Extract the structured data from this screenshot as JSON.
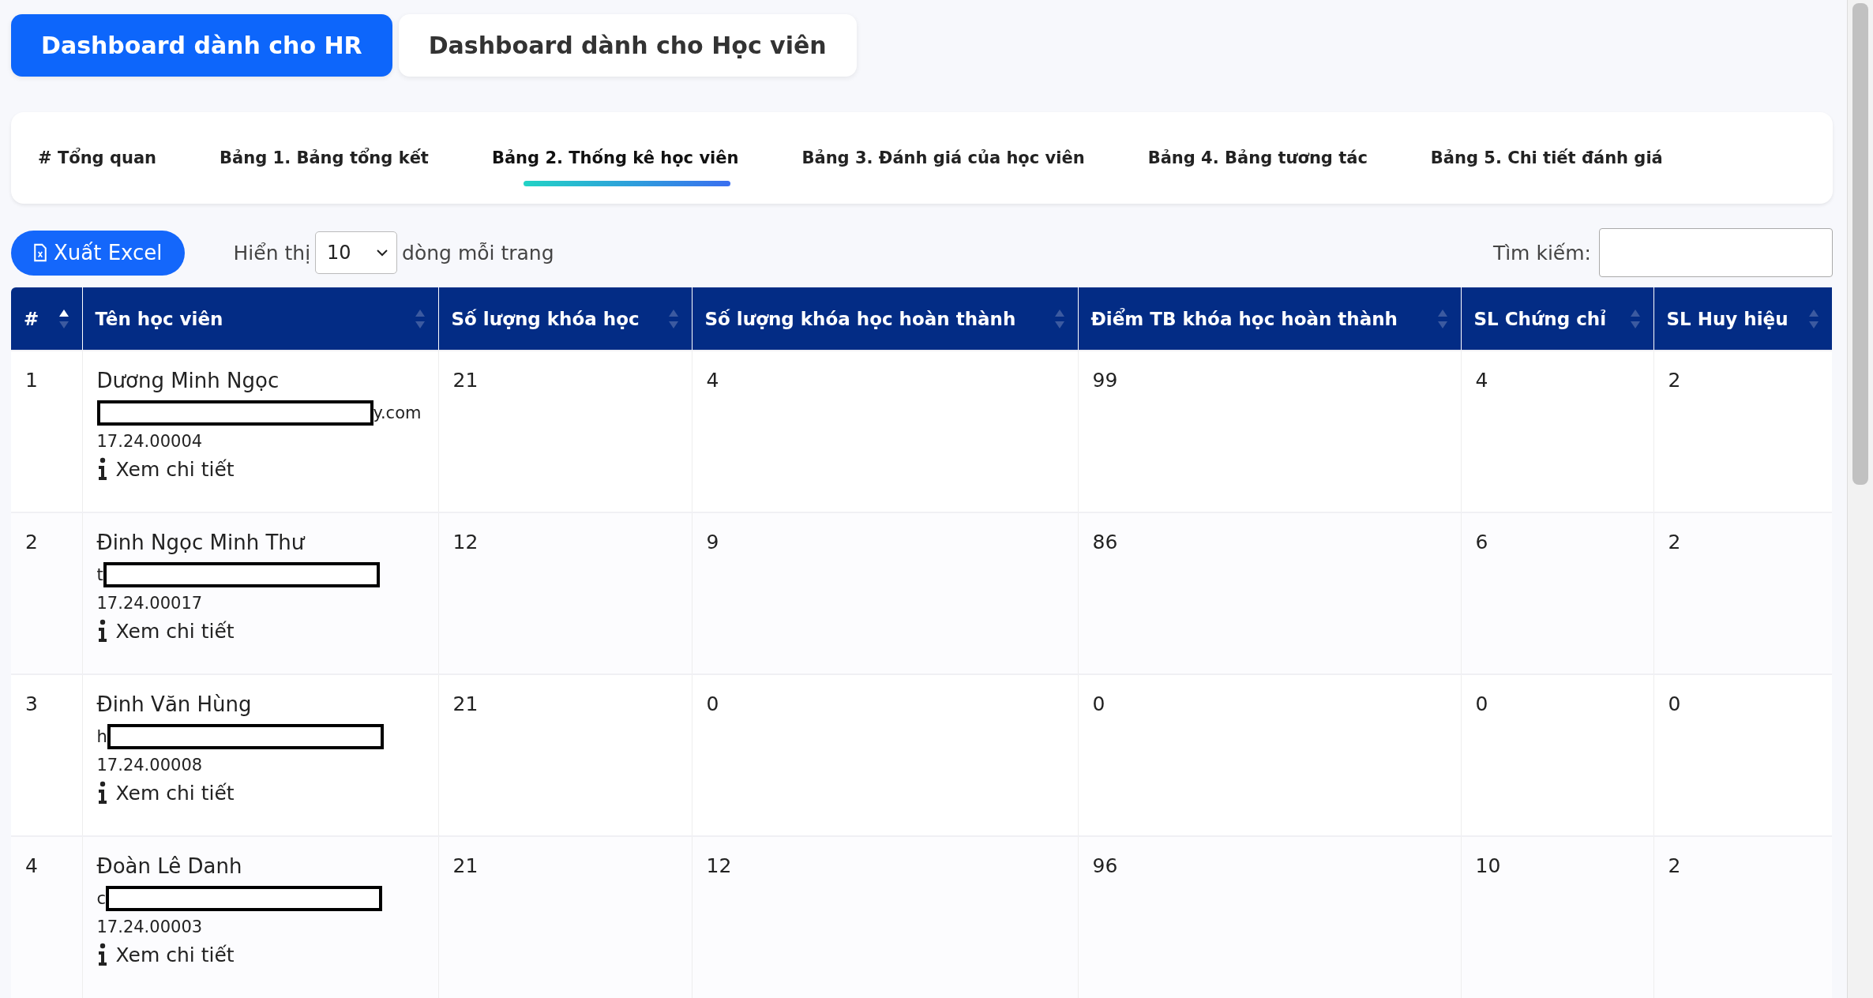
{
  "dashboard_tabs": [
    {
      "label": "Dashboard dành cho HR",
      "selected": true
    },
    {
      "label": "Dashboard dành cho Học viên",
      "selected": false
    }
  ],
  "sub_tabs": [
    {
      "label": "# Tổng quan",
      "selected": false
    },
    {
      "label": "Bảng 1. Bảng tổng kết",
      "selected": false
    },
    {
      "label": "Bảng 2. Thống kê học viên",
      "selected": true
    },
    {
      "label": "Bảng 3. Đánh giá của học viên",
      "selected": false
    },
    {
      "label": "Bảng 4. Bảng tương tác",
      "selected": false
    },
    {
      "label": "Bảng 5. Chi tiết đánh giá",
      "selected": false
    }
  ],
  "toolbar": {
    "export_button": "Xuất Excel",
    "show_label": "Hiển thị",
    "page_size": "10",
    "page_size_suffix": "dòng mỗi trang",
    "search_label": "Tìm kiếm:"
  },
  "table": {
    "columns": [
      {
        "label": "#",
        "sorted_ascending": true
      },
      {
        "label": "Tên học viên",
        "sorted_ascending": false
      },
      {
        "label": "Số lượng khóa học",
        "sorted_ascending": false
      },
      {
        "label": "Số lượng khóa học hoàn thành",
        "sorted_ascending": false
      },
      {
        "label": "Điểm TB khóa học hoàn thành",
        "sorted_ascending": false
      },
      {
        "label": "SL Chứng chỉ",
        "sorted_ascending": false
      },
      {
        "label": "SL Huy hiệu",
        "sorted_ascending": false
      }
    ],
    "rows": [
      {
        "index": "1",
        "name": "Dương Minh Ngọc",
        "email_visible": "y.com",
        "redaction_before": true,
        "code": "17.24.00004",
        "details_link": "Xem chi tiết",
        "courses": "21",
        "completed": "4",
        "avg_score": "99",
        "certificates": "4",
        "badges": "2"
      },
      {
        "index": "2",
        "name": "Đinh Ngọc Minh Thư",
        "email_visible": "t",
        "redaction_before": false,
        "code": "17.24.00017",
        "details_link": "Xem chi tiết",
        "courses": "12",
        "completed": "9",
        "avg_score": "86",
        "certificates": "6",
        "badges": "2"
      },
      {
        "index": "3",
        "name": "Đinh Văn Hùng",
        "email_visible": "h",
        "redaction_before": false,
        "code": "17.24.00008",
        "details_link": "Xem chi tiết",
        "courses": "21",
        "completed": "0",
        "avg_score": "0",
        "certificates": "0",
        "badges": "0"
      },
      {
        "index": "4",
        "name": "Đoàn Lê Danh",
        "email_visible": "c",
        "redaction_before": false,
        "code": "17.24.00003",
        "details_link": "Xem chi tiết",
        "courses": "21",
        "completed": "12",
        "avg_score": "96",
        "certificates": "10",
        "badges": "2"
      }
    ]
  }
}
